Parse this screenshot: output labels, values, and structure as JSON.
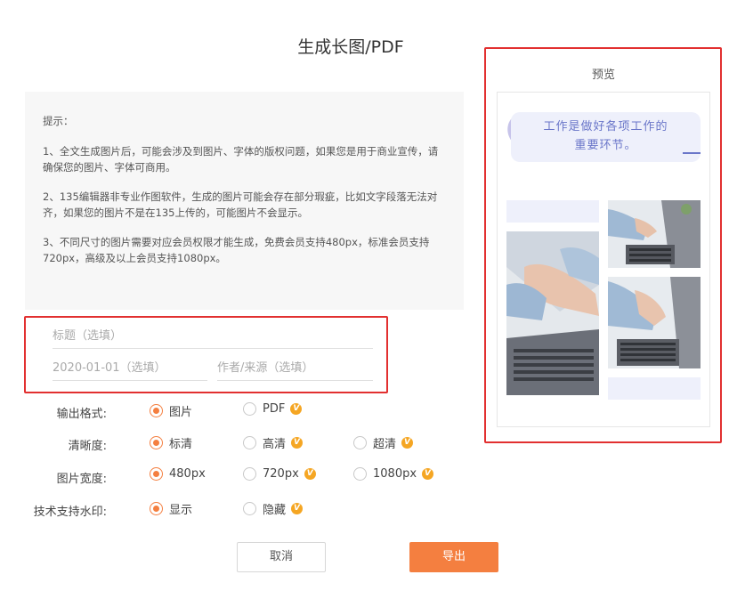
{
  "dialog": {
    "title": "生成长图/PDF"
  },
  "tips": {
    "head": "提示：",
    "items": [
      "1、全文生成图片后，可能会涉及到图片、字体的版权问题，如果您是用于商业宣传，请确保您的图片、字体可商用。",
      "2、135编辑器非专业作图软件，生成的图片可能会存在部分瑕疵，比如文字段落无法对齐，如果您的图片不是在135上传的，可能图片不会显示。",
      "3、不同尺寸的图片需要对应会员权限才能生成，免费会员支持480px，标准会员支持720px，高级及以上会员支持1080px。"
    ]
  },
  "form": {
    "title_placeholder": "标题（选填）",
    "date_placeholder": "2020-01-01（选填）",
    "author_placeholder": "作者/来源（选填）"
  },
  "options": {
    "format": {
      "label": "输出格式:",
      "choices": [
        "图片",
        "PDF"
      ],
      "selected": "图片"
    },
    "clarity": {
      "label": "清晰度:",
      "choices": [
        "标清",
        "高清",
        "超清"
      ],
      "selected": "标清"
    },
    "width": {
      "label": "图片宽度:",
      "choices": [
        "480px",
        "720px",
        "1080px"
      ],
      "selected": "480px"
    },
    "watermark": {
      "label": "技术支持水印:",
      "choices": [
        "显示",
        "隐藏"
      ],
      "selected": "显示"
    },
    "vip_badge": "V"
  },
  "buttons": {
    "cancel": "取消",
    "export": "导出"
  },
  "preview": {
    "label": "预览",
    "bubble_text_line1": "工作是做好各项工作的",
    "bubble_text_line2": "重要环节。"
  },
  "colors": {
    "accent": "#f47f40",
    "vip": "#f5a623",
    "highlight": "#e23030",
    "preview_text": "#6a76c9",
    "preview_bg": "#eef0fb"
  }
}
